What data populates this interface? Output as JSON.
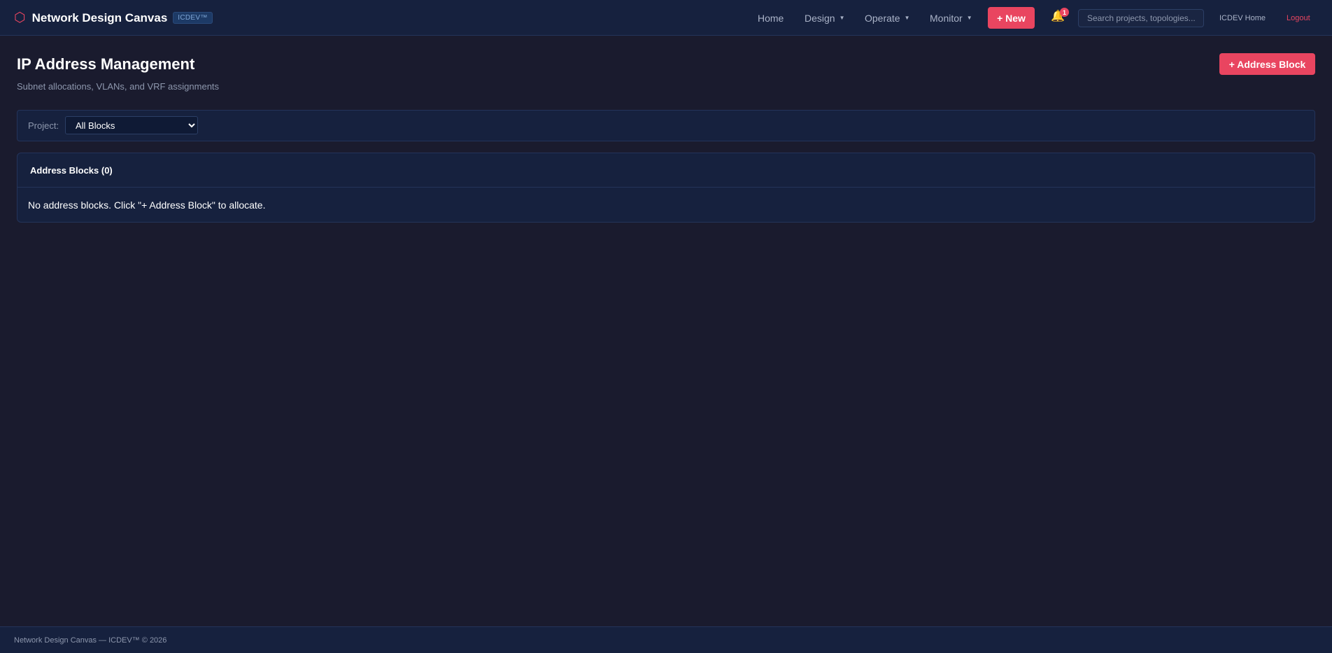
{
  "navbar": {
    "brand_title": "Network Design Canvas",
    "brand_badge": "ICDEV™",
    "brand_icon": "hexagon-icon",
    "links": {
      "home": "Home",
      "design": "Design",
      "operate": "Operate",
      "monitor": "Monitor"
    },
    "new_label": "+ New",
    "notification_count": "1",
    "search_placeholder": "Search projects, topologies...",
    "icdev_home": "ICDEV Home",
    "logout": "Logout"
  },
  "page": {
    "title": "IP Address Management",
    "subtitle": "Subnet allocations, VLANs, and VRF assignments",
    "add_block_label": "+ Address Block"
  },
  "filter": {
    "label": "Project:",
    "selected": "All Blocks"
  },
  "address_blocks": {
    "title": "Address Blocks (0)",
    "empty_message": "No address blocks. Click \"+ Address Block\" to allocate."
  },
  "footer": {
    "text": "Network Design Canvas — ICDEV™ © 2026"
  },
  "colors": {
    "background": "#1a1b2e",
    "panel": "#16213e",
    "accent": "#e94560",
    "bell": "#f5a623"
  }
}
